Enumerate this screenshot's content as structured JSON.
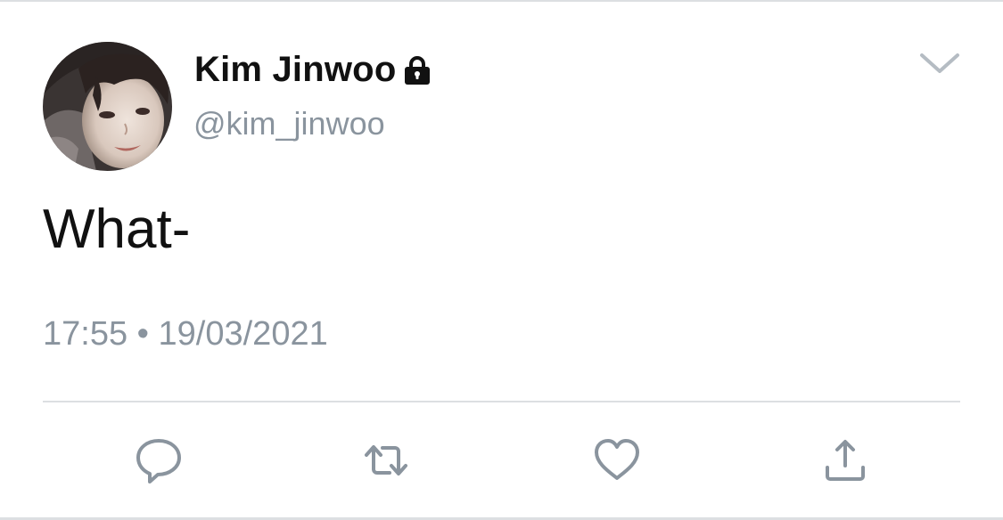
{
  "tweet": {
    "author": {
      "display_name": "Kim Jinwoo",
      "handle": "@kim_jinwoo",
      "protected_icon": "lock-icon",
      "avatar": "profile-photo"
    },
    "text": "What-",
    "time": "17:55",
    "separator": "•",
    "date": "19/03/2021",
    "menu_icon": "chevron-down-icon"
  },
  "actions": [
    {
      "name": "reply",
      "icon": "reply-icon"
    },
    {
      "name": "retweet",
      "icon": "retweet-icon"
    },
    {
      "name": "like",
      "icon": "heart-icon"
    },
    {
      "name": "share",
      "icon": "share-icon"
    }
  ],
  "colors": {
    "text_primary": "#111111",
    "text_secondary": "#8a949e",
    "icon": "#8a949e",
    "divider": "#dcdfe2",
    "background": "#ffffff"
  }
}
